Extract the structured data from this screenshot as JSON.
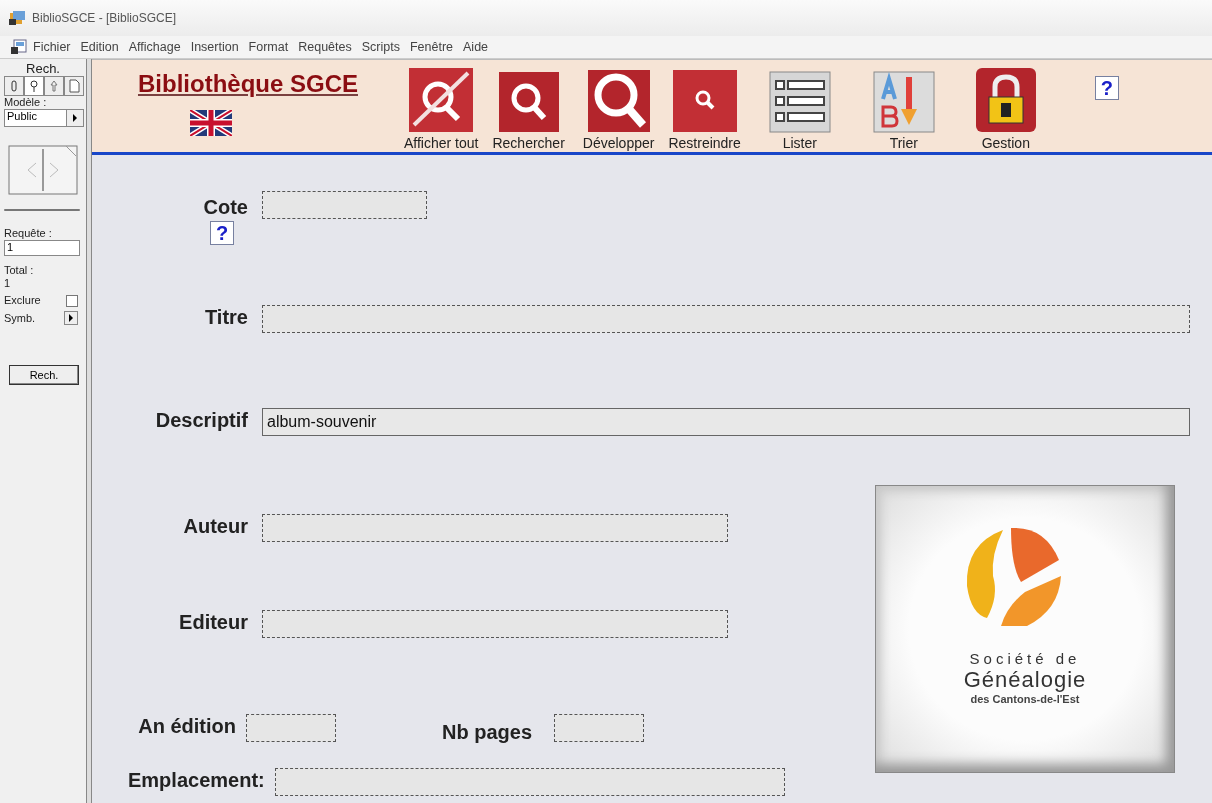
{
  "window": {
    "title": "BiblioSGCE - [BiblioSGCE]"
  },
  "menu": [
    "Fichier",
    "Edition",
    "Affichage",
    "Insertion",
    "Format",
    "Requêtes",
    "Scripts",
    "Fenêtre",
    "Aide"
  ],
  "sidebar": {
    "title": "Rech.",
    "model_label": "Modèle :",
    "model_value": "Public",
    "query_label": "Requête :",
    "query_value": "1",
    "total_label": "Total :",
    "total_value": "1",
    "exclude": {
      "label": "Exclure",
      "checked": false
    },
    "symbols_label": "Symb.",
    "search_button": "Rech."
  },
  "header": {
    "title": "Bibliothèque SGCE",
    "help": "?",
    "toolbar": [
      {
        "label": "Afficher tout",
        "kind": "clear"
      },
      {
        "label": "Rechercher",
        "kind": "search"
      },
      {
        "label": "Développer",
        "kind": "expand"
      },
      {
        "label": "Restreindre",
        "kind": "narrow"
      },
      {
        "label": "Lister",
        "kind": "list"
      },
      {
        "label": "Trier",
        "kind": "sort"
      },
      {
        "label": "Gestion",
        "kind": "lock"
      }
    ]
  },
  "form": {
    "fields": [
      {
        "label": "Cote",
        "help": "?"
      },
      {
        "label": "Titre"
      },
      {
        "label": "Descriptif",
        "value": "album-souvenir"
      },
      {
        "label": "Auteur"
      },
      {
        "label": "Editeur"
      }
    ],
    "edition_year": {
      "label": "An édition"
    },
    "pages": {
      "label": "Nb pages"
    },
    "location": {
      "label": "Emplacement:"
    }
  },
  "logo": {
    "line_1": "Société de",
    "line_2": "Généalogie",
    "line_3": "des Cantons-de-l'Est"
  }
}
